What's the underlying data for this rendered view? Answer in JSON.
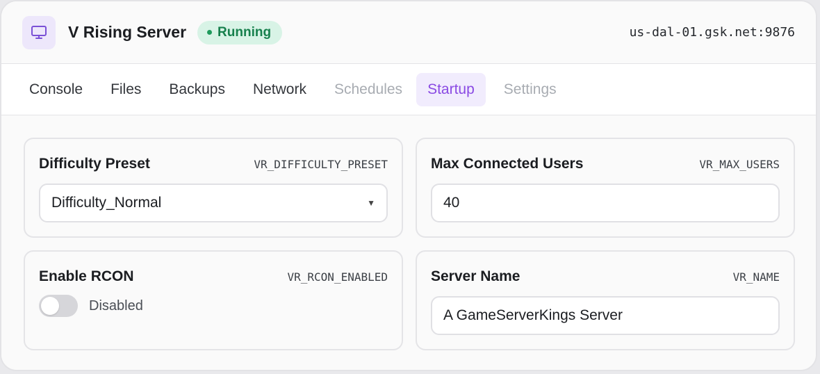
{
  "header": {
    "icon": "monitor-icon",
    "title": "V Rising Server",
    "status": "Running",
    "address": "us-dal-01.gsk.net:9876"
  },
  "tabs": [
    {
      "label": "Console",
      "state": "enabled"
    },
    {
      "label": "Files",
      "state": "enabled"
    },
    {
      "label": "Backups",
      "state": "enabled"
    },
    {
      "label": "Network",
      "state": "enabled"
    },
    {
      "label": "Schedules",
      "state": "disabled"
    },
    {
      "label": "Startup",
      "state": "active"
    },
    {
      "label": "Settings",
      "state": "disabled"
    }
  ],
  "settings": {
    "difficulty": {
      "title": "Difficulty Preset",
      "variable": "VR_DIFFICULTY_PRESET",
      "value": "Difficulty_Normal"
    },
    "max_users": {
      "title": "Max Connected Users",
      "variable": "VR_MAX_USERS",
      "value": "40"
    },
    "rcon": {
      "title": "Enable RCON",
      "variable": "VR_RCON_ENABLED",
      "enabled": false,
      "state_label": "Disabled"
    },
    "server_name": {
      "title": "Server Name",
      "variable": "VR_NAME",
      "value": "A GameServerKings Server"
    }
  },
  "colors": {
    "accent": "#8a4ae3",
    "status_bg": "#d8f3e6",
    "status_text": "#17804d"
  }
}
